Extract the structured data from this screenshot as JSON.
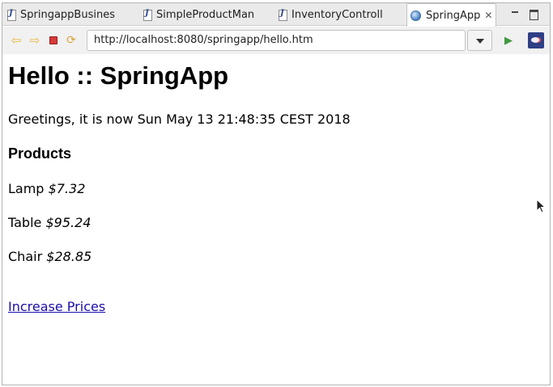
{
  "tabs": [
    {
      "label": "SpringappBusines",
      "icon": "java-file-icon"
    },
    {
      "label": "SimpleProductMan",
      "icon": "java-file-icon"
    },
    {
      "label": "InventoryControll",
      "icon": "java-file-icon"
    },
    {
      "label": "SpringApp",
      "icon": "globe-icon",
      "active": true,
      "close": "✕"
    }
  ],
  "toolbar": {
    "url": "http://localhost:8080/springapp/hello.htm"
  },
  "page": {
    "heading": "Hello :: SpringApp",
    "greeting": "Greetings, it is now Sun May 13 21:48:35 CEST 2018",
    "products_heading": "Products",
    "products": [
      {
        "name": "Lamp",
        "price": "$7.32"
      },
      {
        "name": "Table",
        "price": "$95.24"
      },
      {
        "name": "Chair",
        "price": "$28.85"
      }
    ],
    "link_text": "Increase Prices"
  },
  "colors": {
    "link": "#1a0dab",
    "stop": "#d63a3a",
    "go": "#3f9a3f"
  }
}
